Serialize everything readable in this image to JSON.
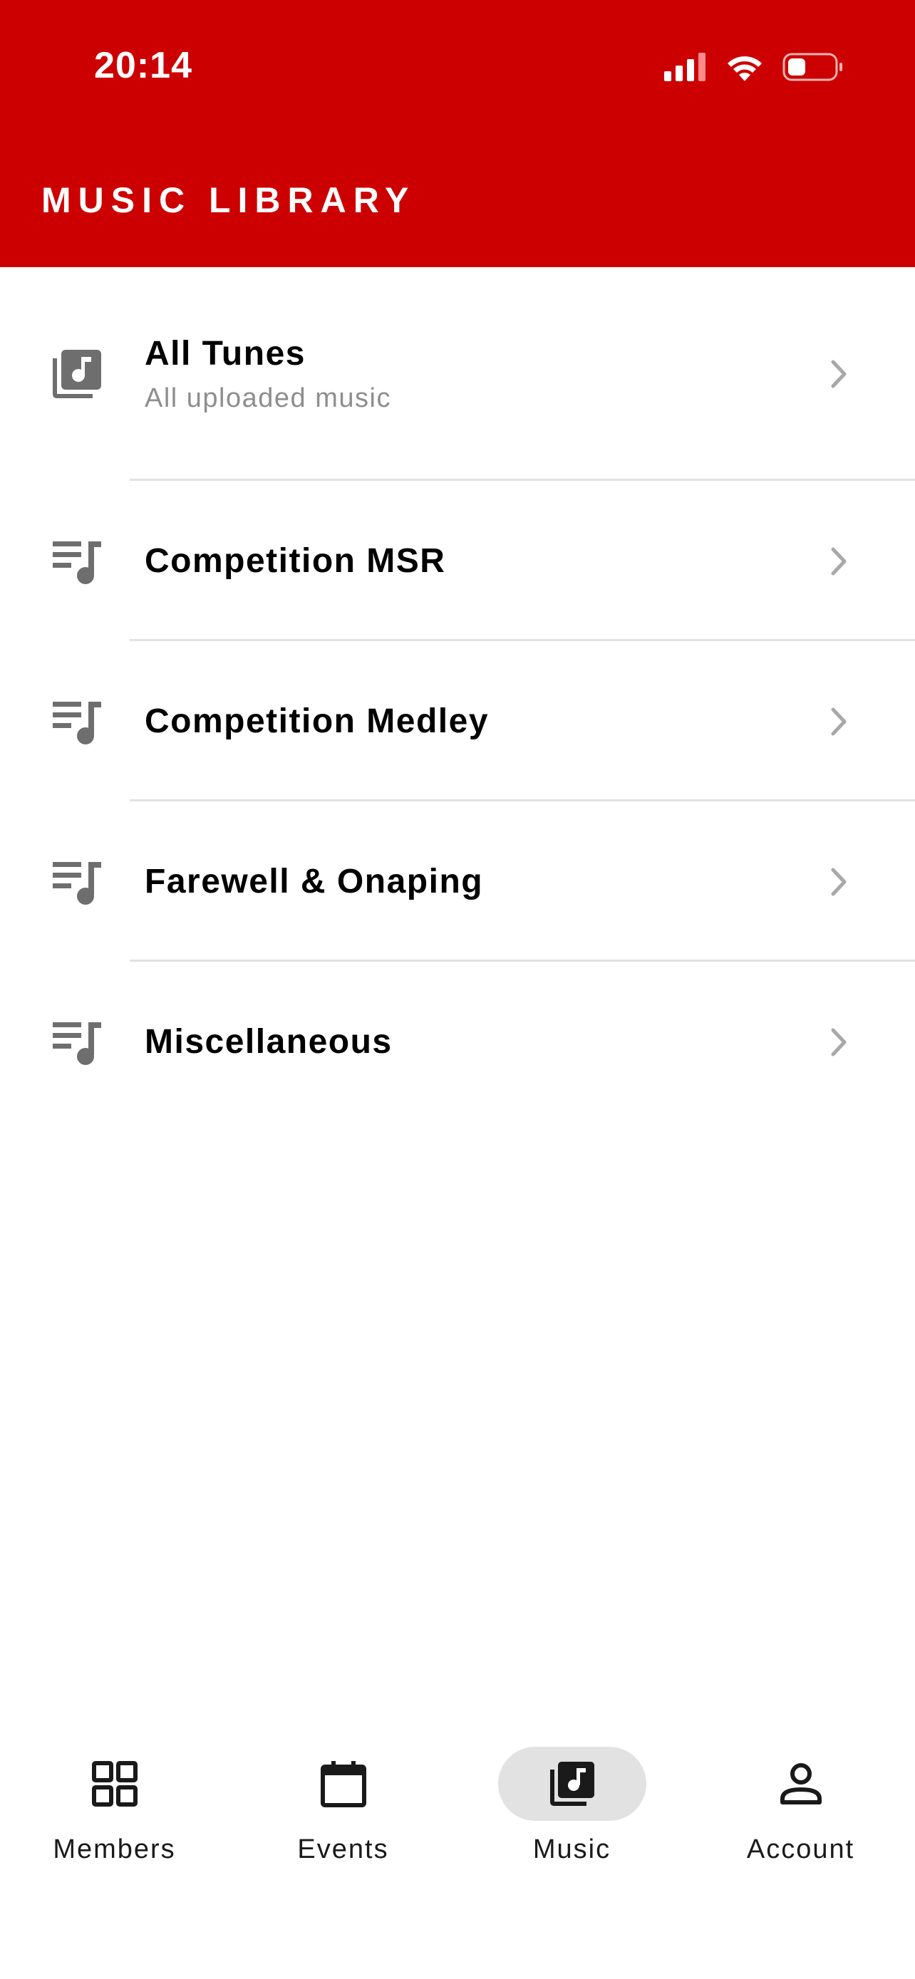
{
  "status_bar": {
    "time": "20:14",
    "icons": [
      "signal-icon",
      "wifi-icon",
      "battery-icon"
    ]
  },
  "header": {
    "title": "MUSIC LIBRARY",
    "background_color": "#CC0000"
  },
  "library": {
    "items": [
      {
        "title": "All Tunes",
        "subtitle": "All uploaded music",
        "icon": "music-library-icon"
      },
      {
        "title": "Competition MSR",
        "icon": "playlist-icon"
      },
      {
        "title": "Competition Medley",
        "icon": "playlist-icon"
      },
      {
        "title": "Farewell & Onaping",
        "icon": "playlist-icon"
      },
      {
        "title": "Miscellaneous",
        "icon": "playlist-icon"
      }
    ]
  },
  "tab_bar": {
    "active_tab": "Music",
    "tabs": [
      {
        "label": "Members",
        "icon": "grid-icon"
      },
      {
        "label": "Events",
        "icon": "calendar-icon"
      },
      {
        "label": "Music",
        "icon": "music-library-icon"
      },
      {
        "label": "Account",
        "icon": "person-icon"
      }
    ]
  }
}
